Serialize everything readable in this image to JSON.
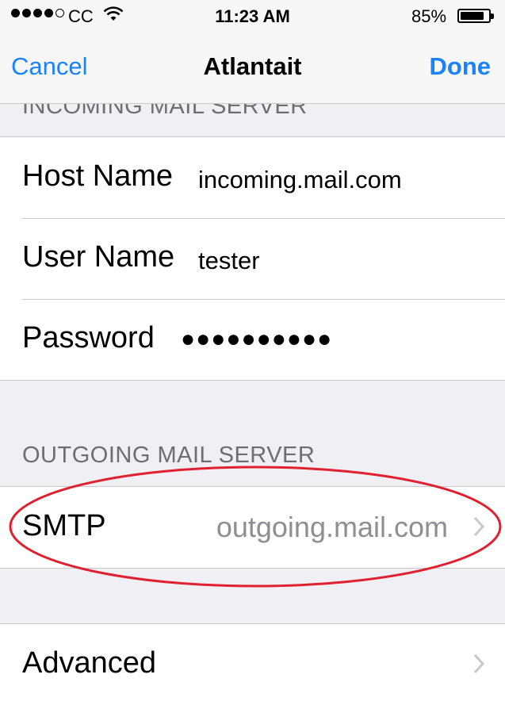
{
  "status_bar": {
    "carrier": "CC",
    "time": "11:23 AM",
    "battery_percent_text": "85%",
    "battery_level": 0.85,
    "signal_bars_filled": 4,
    "signal_bars_total": 5
  },
  "nav": {
    "cancel_label": "Cancel",
    "title": "Atlantait",
    "done_label": "Done"
  },
  "incoming": {
    "header": "INCOMING MAIL SERVER",
    "host_label": "Host Name",
    "host_value": "incoming.mail.com",
    "user_label": "User Name",
    "user_value": "tester",
    "password_label": "Password",
    "password_mask": "●●●●●●●●●●"
  },
  "outgoing": {
    "header": "OUTGOING MAIL SERVER",
    "smtp_label": "SMTP",
    "smtp_value": "outgoing.mail.com"
  },
  "advanced": {
    "label": "Advanced"
  },
  "colors": {
    "accent": "#1a82fb",
    "annotation": "#e0202e",
    "background": "#efeff4"
  }
}
